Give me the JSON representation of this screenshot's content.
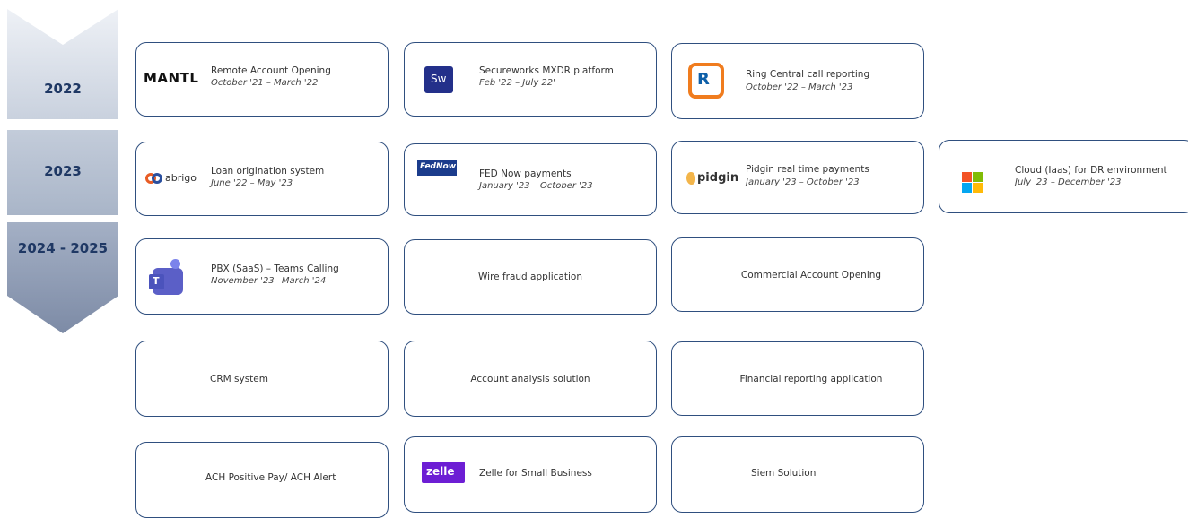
{
  "years": [
    "2022",
    "2023",
    "2024 - 2025"
  ],
  "cards": {
    "mantl": {
      "logo_text": "MANTL",
      "title": "Remote Account Opening",
      "dates": "October '21 – March '22"
    },
    "secureworks": {
      "logo_text": "Sw",
      "title": "Secureworks MXDR platform",
      "dates": "Feb '22 – July 22'"
    },
    "ringcentral": {
      "logo_text": "R",
      "title": "Ring Central call reporting",
      "dates": "October '22 – March '23"
    },
    "abrigo": {
      "logo_text": "abrigo",
      "title": "Loan origination system",
      "dates": "June '22 – May '23"
    },
    "fednow": {
      "logo_text": "FedNow",
      "title": "FED Now payments",
      "dates": "January '23 – October '23"
    },
    "pidgin": {
      "logo_text": "pidgin",
      "title": "Pidgin real time payments",
      "dates": "January '23 – October '23"
    },
    "cloud": {
      "title": "Cloud (Iaas) for DR environment",
      "dates": "July '23 – December '23"
    },
    "pbx": {
      "logo_text": "T",
      "title": "PBX (SaaS) – Teams Calling",
      "dates": "November '23– March '24"
    },
    "wire": {
      "title": "Wire fraud application"
    },
    "commercial": {
      "title": "Commercial Account Opening"
    },
    "crm": {
      "title": "CRM system"
    },
    "analysis": {
      "title": "Account analysis solution"
    },
    "financial": {
      "title": "Financial reporting application"
    },
    "ach": {
      "title": "ACH Positive Pay/ ACH Alert"
    },
    "zelle": {
      "logo_text": "zelle",
      "title": "Zelle for Small Business"
    },
    "siem": {
      "title": "Siem Solution"
    }
  },
  "colors": {
    "border": "#2f4f7f",
    "year_text": "#1f3864",
    "ribbon_light": "#dde3ec",
    "ribbon_dark": "#8e9bb3"
  }
}
